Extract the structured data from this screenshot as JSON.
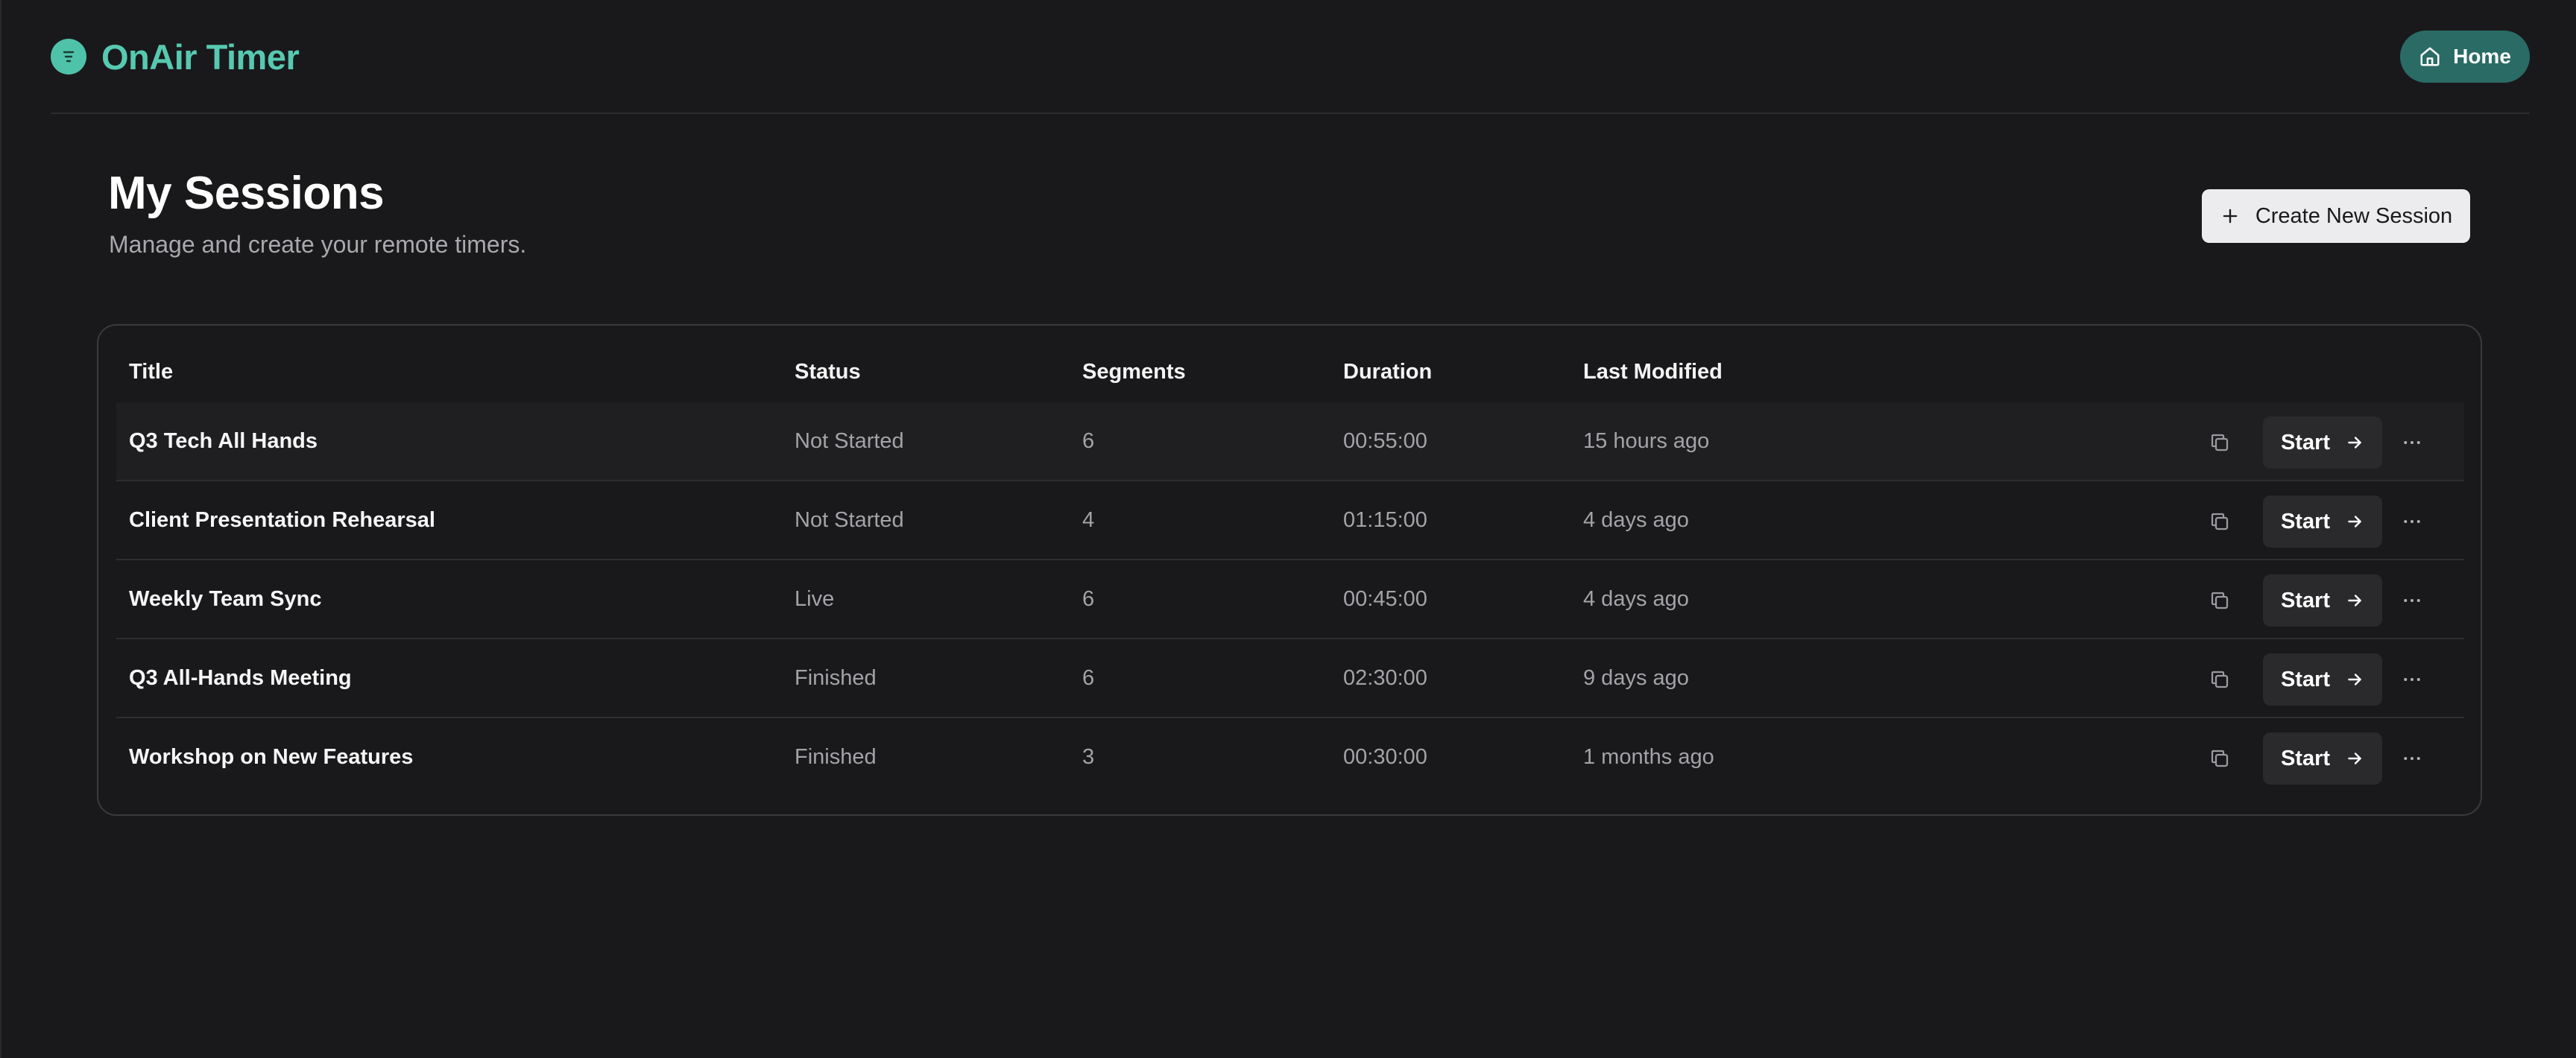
{
  "app": {
    "name": "OnAir Timer",
    "brand_icon": "list-icon",
    "accent_color": "#57c9b0"
  },
  "header": {
    "home_label": "Home",
    "home_icon": "home-icon"
  },
  "page": {
    "title": "My Sessions",
    "subtitle": "Manage and create your remote timers.",
    "create_label": "Create New Session",
    "create_icon": "plus-icon"
  },
  "table": {
    "columns": {
      "title": "Title",
      "status": "Status",
      "segments": "Segments",
      "duration": "Duration",
      "last_modified": "Last Modified"
    },
    "start_label": "Start",
    "rows": [
      {
        "title": "Q3 Tech All Hands",
        "status": "Not Started",
        "segments": "6",
        "duration": "00:55:00",
        "last_modified": "15 hours ago"
      },
      {
        "title": "Client Presentation Rehearsal",
        "status": "Not Started",
        "segments": "4",
        "duration": "01:15:00",
        "last_modified": "4 days ago"
      },
      {
        "title": "Weekly Team Sync",
        "status": "Live",
        "segments": "6",
        "duration": "00:45:00",
        "last_modified": "4 days ago"
      },
      {
        "title": "Q3 All-Hands Meeting",
        "status": "Finished",
        "segments": "6",
        "duration": "02:30:00",
        "last_modified": "9 days ago"
      },
      {
        "title": "Workshop on New Features",
        "status": "Finished",
        "segments": "3",
        "duration": "00:30:00",
        "last_modified": "1 months ago"
      }
    ]
  }
}
